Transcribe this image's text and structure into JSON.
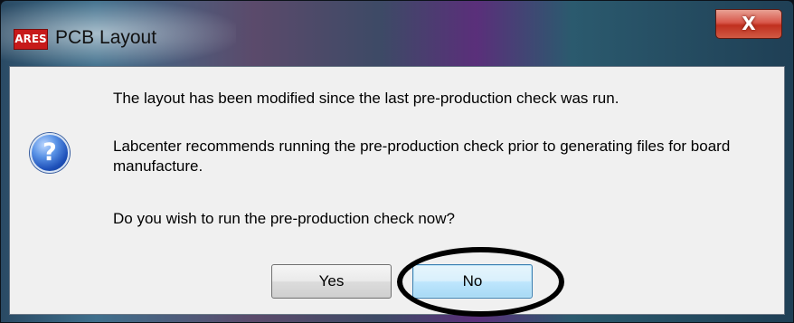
{
  "window": {
    "title": "PCB Layout",
    "app_icon_text": "ARES",
    "close_glyph": "X"
  },
  "message": {
    "line1": "The layout has been modified since the last pre-production check was run.",
    "line2": "Labcenter recommends running the pre-production check prior to generating files for board manufacture.",
    "line3": "Do you wish to run the pre-production check now?"
  },
  "icon": {
    "name": "question-icon",
    "glyph": "?"
  },
  "buttons": {
    "yes_label": "Yes",
    "no_label": "No"
  },
  "colors": {
    "accent": "#c71a1a",
    "close": "#c0301f",
    "focus": "#3c7fb1"
  }
}
